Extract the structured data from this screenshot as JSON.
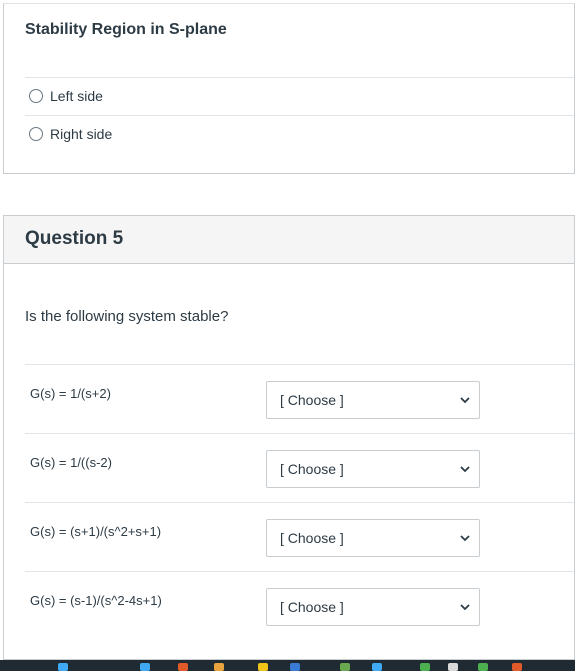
{
  "q4": {
    "title": "Stability Region in S-plane",
    "options": [
      "Left side",
      "Right side"
    ]
  },
  "q5": {
    "title": "Question 5",
    "prompt": "Is the following system stable?",
    "rows": [
      {
        "label": "G(s) = 1/(s+2)",
        "select": "[ Choose ]"
      },
      {
        "label": "G(s) = 1/((s-2)",
        "select": "[ Choose ]"
      },
      {
        "label": "G(s) = (s+1)/(s^2+s+1)",
        "select": "[ Choose ]"
      },
      {
        "label": "G(s) = (s-1)/(s^2-4s+1)",
        "select": "[ Choose ]"
      }
    ]
  },
  "icons": [
    "radio-icon",
    "chevron-down-icon"
  ],
  "colors": {
    "text": "#2d3b45",
    "border": "#c7cdd1",
    "header_bg": "#f5f5f5",
    "taskbar": "#1f2a33"
  }
}
